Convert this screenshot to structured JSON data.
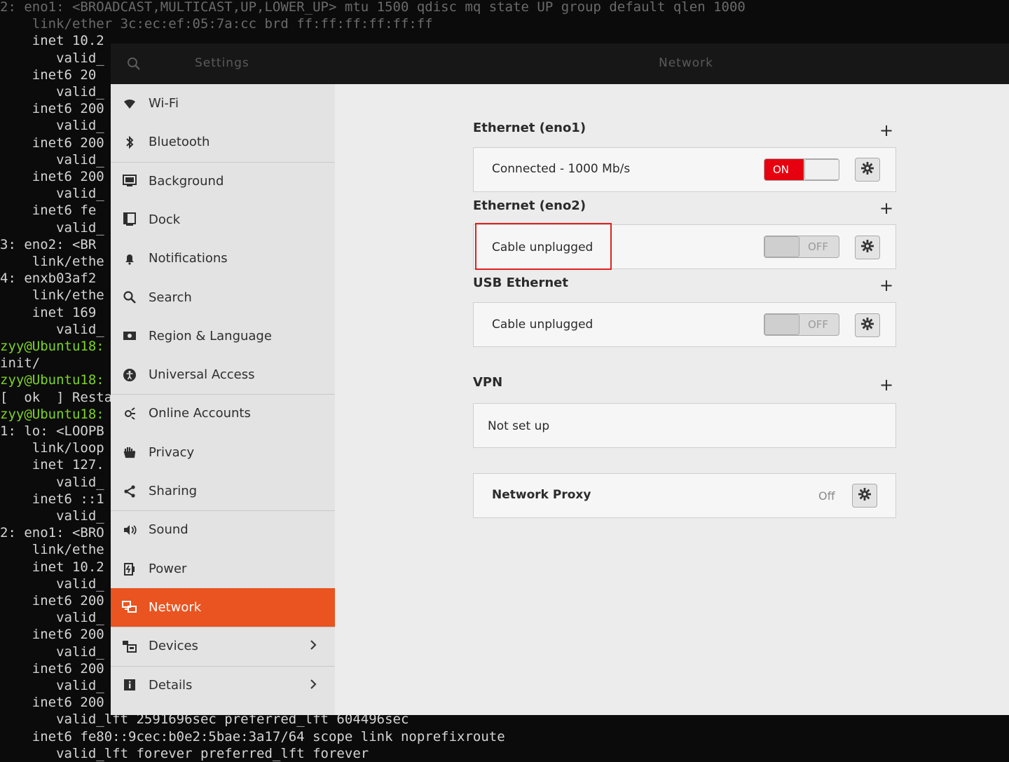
{
  "terminal": {
    "lines": [
      {
        "text": "2: eno1: <BROADCAST,MULTICAST,UP,LOWER_UP> mtu 1500 qdisc mq state UP group default qlen 1000",
        "style": "dim"
      },
      {
        "text": "    link/ether 3c:ec:ef:05:7a:cc brd ff:ff:ff:ff:ff:ff",
        "style": "dim"
      },
      {
        "text": "    inet 10.2",
        "style": "normal"
      },
      {
        "text": "       valid_",
        "style": "normal"
      },
      {
        "text": "    inet6 20",
        "style": "normal"
      },
      {
        "text": "       valid_",
        "style": "normal"
      },
      {
        "text": "    inet6 200",
        "style": "normal"
      },
      {
        "text": "       valid_",
        "style": "normal"
      },
      {
        "text": "    inet6 200",
        "style": "normal"
      },
      {
        "text": "       valid_",
        "style": "normal"
      },
      {
        "text": "    inet6 200",
        "style": "normal"
      },
      {
        "text": "       valid_",
        "style": "normal"
      },
      {
        "text": "    inet6 fe",
        "style": "normal"
      },
      {
        "text": "       valid_",
        "style": "normal"
      },
      {
        "text": "3: eno2: <BR",
        "style": "normal"
      },
      {
        "text": "    link/ethe",
        "style": "normal"
      },
      {
        "text": "4: enxb03af2",
        "style": "normal"
      },
      {
        "text": "    link/ethe",
        "style": "normal"
      },
      {
        "text": "    inet 169",
        "style": "normal"
      },
      {
        "text": "       valid_",
        "style": "normal"
      },
      {
        "text": "zyy@Ubuntu18:",
        "style": "green"
      },
      {
        "text": "init/",
        "style": "normal"
      },
      {
        "text": "zyy@Ubuntu18:",
        "style": "green"
      },
      {
        "text": "[  ok  ] Resta",
        "style": "normal"
      },
      {
        "text": "zyy@Ubuntu18:",
        "style": "green"
      },
      {
        "text": "1: lo: <LOOPB",
        "style": "normal"
      },
      {
        "text": "    link/loop",
        "style": "normal"
      },
      {
        "text": "    inet 127.",
        "style": "normal"
      },
      {
        "text": "       valid_",
        "style": "normal"
      },
      {
        "text": "    inet6 ::1",
        "style": "normal"
      },
      {
        "text": "       valid_",
        "style": "normal"
      },
      {
        "text": "2: eno1: <BRO",
        "style": "normal"
      },
      {
        "text": "    link/ethe",
        "style": "normal"
      },
      {
        "text": "    inet 10.2",
        "style": "normal"
      },
      {
        "text": "       valid_",
        "style": "normal"
      },
      {
        "text": "    inet6 200",
        "style": "normal"
      },
      {
        "text": "       valid_",
        "style": "normal"
      },
      {
        "text": "    inet6 200",
        "style": "normal"
      },
      {
        "text": "       valid_",
        "style": "normal"
      },
      {
        "text": "    inet6 200",
        "style": "normal"
      },
      {
        "text": "       valid_",
        "style": "normal"
      },
      {
        "text": "    inet6 200",
        "style": "normal"
      },
      {
        "text": "       valid_lft 2591696sec preferred_lft 604496sec",
        "style": "normal"
      },
      {
        "text": "    inet6 fe80::9cec:b0e2:5bae:3a17/64 scope link noprefixroute",
        "style": "normal"
      },
      {
        "text": "       valid_lft forever preferred_lft forever",
        "style": "normal"
      }
    ]
  },
  "header": {
    "search_icon": "search-icon",
    "settings_title": "Settings",
    "page_title": "Network"
  },
  "sidebar": {
    "items": [
      {
        "label": "Wi-Fi",
        "icon": "wifi-icon"
      },
      {
        "label": "Bluetooth",
        "icon": "bluetooth-icon"
      },
      {
        "label": "Background",
        "icon": "background-icon"
      },
      {
        "label": "Dock",
        "icon": "dock-icon"
      },
      {
        "label": "Notifications",
        "icon": "bell-icon"
      },
      {
        "label": "Search",
        "icon": "search-icon"
      },
      {
        "label": "Region & Language",
        "icon": "region-icon"
      },
      {
        "label": "Universal Access",
        "icon": "accessibility-icon"
      },
      {
        "label": "Online Accounts",
        "icon": "online-accounts-icon"
      },
      {
        "label": "Privacy",
        "icon": "hand-icon"
      },
      {
        "label": "Sharing",
        "icon": "share-icon"
      },
      {
        "label": "Sound",
        "icon": "speaker-icon"
      },
      {
        "label": "Power",
        "icon": "power-icon"
      },
      {
        "label": "Network",
        "icon": "network-icon",
        "active": true
      },
      {
        "label": "Devices",
        "icon": "devices-icon",
        "has_submenu": true
      },
      {
        "label": "Details",
        "icon": "info-icon",
        "has_submenu": true
      }
    ],
    "active_color": "#e95420"
  },
  "network": {
    "ethernet_eno1": {
      "title": "Ethernet (eno1)",
      "status": "Connected - 1000 Mb/s",
      "toggle": "ON"
    },
    "ethernet_eno2": {
      "title": "Ethernet (eno2)",
      "status": "Cable unplugged",
      "toggle": "OFF"
    },
    "usb_ethernet": {
      "title": "USB Ethernet",
      "status": "Cable unplugged",
      "toggle": "OFF"
    },
    "vpn": {
      "title": "VPN",
      "status": "Not set up"
    },
    "proxy": {
      "label": "Network Proxy",
      "status": "Off"
    },
    "add_symbol": "+",
    "toggle_on_color": "#e7000f",
    "highlight_color": "#e02020"
  }
}
